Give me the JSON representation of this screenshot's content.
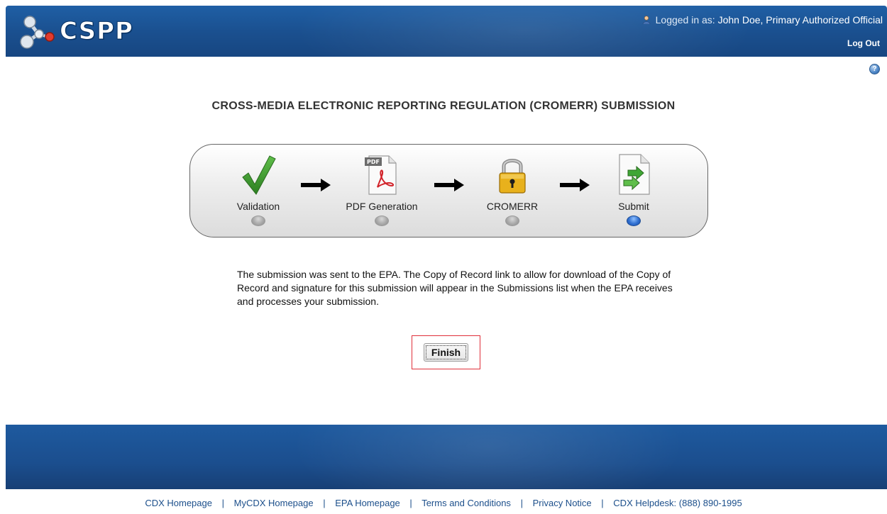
{
  "header": {
    "logo_text": "CSPP",
    "logged_in_prefix": "Logged in as:",
    "user": "John Doe, Primary Authorized Official",
    "logout_label": "Log Out"
  },
  "help": {
    "glyph": "?"
  },
  "page_title": "CROSS-MEDIA ELECTRONIC REPORTING REGULATION (CROMERR) SUBMISSION",
  "progress": {
    "steps": [
      {
        "label": "Validation",
        "icon": "checkmark-icon",
        "active": false
      },
      {
        "label": "PDF Generation",
        "icon": "pdf-document-icon",
        "active": false
      },
      {
        "label": "CROMERR",
        "icon": "padlock-icon",
        "active": false
      },
      {
        "label": "Submit",
        "icon": "submit-document-icon",
        "active": true
      }
    ],
    "pdf_badge": "PDF"
  },
  "message": "The submission was sent to the EPA. The Copy of Record link to allow for download of the Copy of Record and signature for this submission will appear in the Submissions list when the EPA receives and processes your submission.",
  "finish_label": "Finish",
  "footer": {
    "links": [
      "CDX Homepage",
      "MyCDX Homepage",
      "EPA Homepage",
      "Terms and Conditions",
      "Privacy Notice",
      "CDX Helpdesk: (888) 890-1995"
    ],
    "separator": "|"
  },
  "colors": {
    "header_blue": "#1a4f8e",
    "active_dot": "#2f6fd0",
    "highlight_red": "#e0303a",
    "link_blue": "#1c4f8b"
  }
}
